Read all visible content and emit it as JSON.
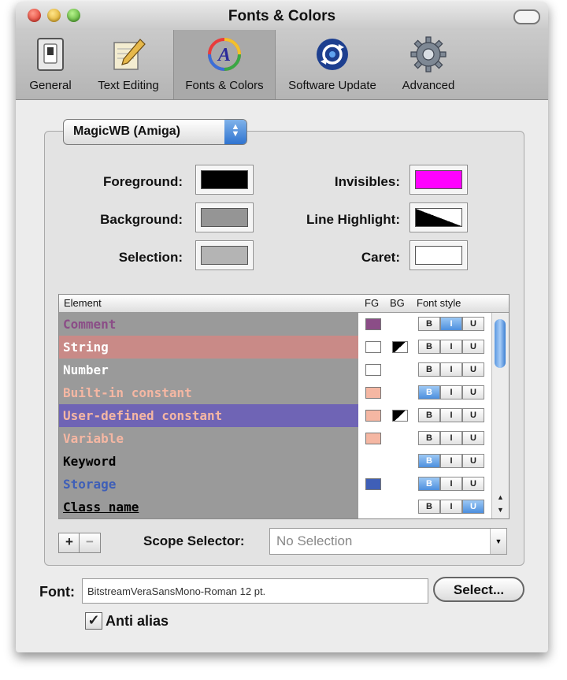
{
  "window": {
    "title": "Fonts & Colors"
  },
  "toolbar": {
    "items": [
      {
        "label": "General",
        "icon": "general-switch-icon",
        "active": false
      },
      {
        "label": "Text Editing",
        "icon": "pencil-paper-icon",
        "active": false
      },
      {
        "label": "Fonts & Colors",
        "icon": "font-color-icon",
        "active": true
      },
      {
        "label": "Software Update",
        "icon": "update-arrows-icon",
        "active": false
      },
      {
        "label": "Advanced",
        "icon": "gear-icon",
        "active": false
      }
    ]
  },
  "theme": {
    "selected": "MagicWB (Amiga)"
  },
  "colors": {
    "foreground": {
      "label": "Foreground:",
      "value": "#000000"
    },
    "background": {
      "label": "Background:",
      "value": "#959595"
    },
    "selection": {
      "label": "Selection:",
      "value": "#b4b4b4"
    },
    "invisibles": {
      "label": "Invisibles:",
      "value": "#ff00ff"
    },
    "line_highlight": {
      "label": "Line Highlight:",
      "value": "black-white-split"
    },
    "caret": {
      "label": "Caret:",
      "value": "#ffffff"
    }
  },
  "table": {
    "headers": {
      "element": "Element",
      "fg": "FG",
      "bg": "BG",
      "font_style": "Font style"
    },
    "rows": [
      {
        "name": "Comment",
        "text_color": "#8b4d87",
        "row_bg": "#9a9a9a",
        "fg": "#8b4d87",
        "bg": "none",
        "b": false,
        "i": true,
        "u": false
      },
      {
        "name": "String",
        "text_color": "#ffffff",
        "row_bg": "#c98a87",
        "fg": "#ffffff",
        "bg": "split",
        "b": false,
        "i": false,
        "u": false
      },
      {
        "name": "Number",
        "text_color": "#ffffff",
        "row_bg": "#9a9a9a",
        "fg": "#ffffff",
        "bg": "none",
        "b": false,
        "i": false,
        "u": false
      },
      {
        "name": "Built-in constant",
        "text_color": "#f5b7a3",
        "row_bg": "#9a9a9a",
        "fg": "#f5b7a3",
        "bg": "none",
        "b": true,
        "i": false,
        "u": false
      },
      {
        "name": "User-defined constant",
        "text_color": "#f5b7a3",
        "row_bg": "#6f64b5",
        "fg": "#f5b7a3",
        "bg": "split",
        "b": false,
        "i": false,
        "u": false
      },
      {
        "name": "Variable",
        "text_color": "#f5b7a3",
        "row_bg": "#9a9a9a",
        "fg": "#f5b7a3",
        "bg": "none",
        "b": false,
        "i": false,
        "u": false
      },
      {
        "name": "Keyword",
        "text_color": "#000000",
        "row_bg": "#9a9a9a",
        "fg": "none",
        "bg": "none",
        "b": true,
        "i": false,
        "u": false
      },
      {
        "name": "Storage",
        "text_color": "#3f5fb7",
        "row_bg": "#9a9a9a",
        "fg": "#3f5fb7",
        "bg": "none",
        "b": true,
        "i": false,
        "u": false
      },
      {
        "name": "Class name",
        "text_color": "#000000",
        "row_bg": "#9a9a9a",
        "fg": "none",
        "bg": "none",
        "b": false,
        "i": false,
        "u": true
      }
    ],
    "style_labels": {
      "b": "B",
      "i": "I",
      "u": "U"
    }
  },
  "controls": {
    "add_label": "+",
    "remove_label": "−",
    "scope_label": "Scope Selector:",
    "scope_placeholder": "No Selection"
  },
  "font": {
    "label": "Font:",
    "value": "BitstreamVeraSansMono-Roman 12 pt.",
    "select_label": "Select...",
    "anti_alias_label": "Anti alias",
    "anti_alias_checked": true
  }
}
